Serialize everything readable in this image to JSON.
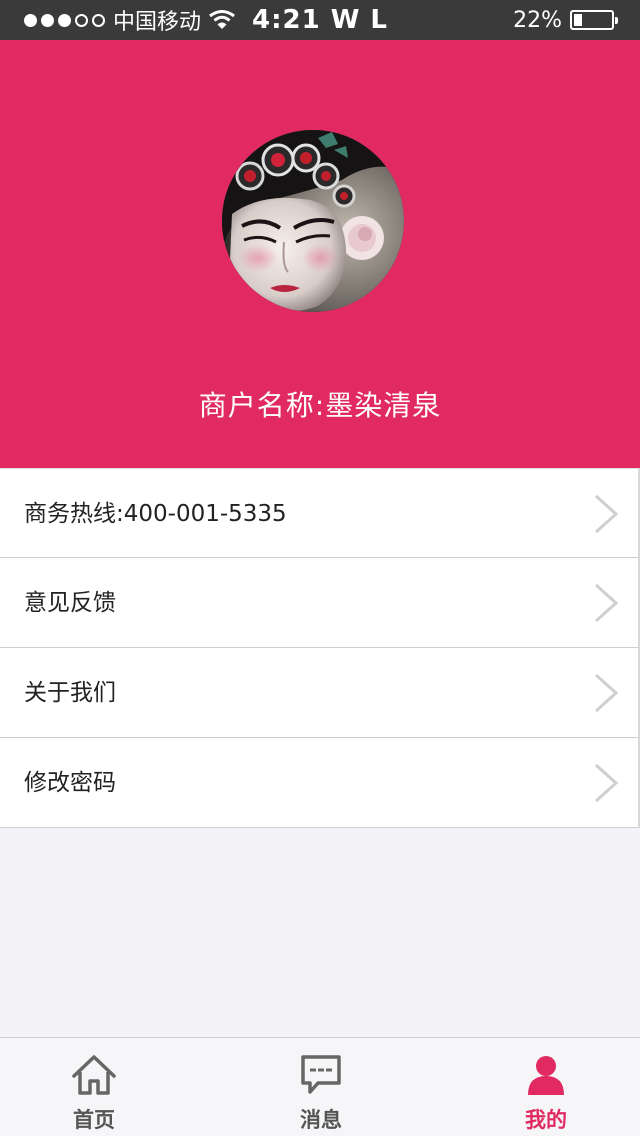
{
  "status_bar": {
    "carrier": "中国移动",
    "time": "4:21 W L",
    "battery_text": "22%",
    "battery_level": 0.22
  },
  "profile": {
    "merchant_name": "商户名称:墨染清泉"
  },
  "menu": [
    {
      "label": "商务热线:400-001-5335"
    },
    {
      "label": "意见反馈"
    },
    {
      "label": "关于我们"
    },
    {
      "label": "修改密码"
    }
  ],
  "tabs": [
    {
      "label": "首页",
      "icon": "home-icon"
    },
    {
      "label": "消息",
      "icon": "message-icon"
    },
    {
      "label": "我的",
      "icon": "user-icon",
      "active": true
    }
  ],
  "colors": {
    "accent": "#e02a61",
    "status_bar": "#3a3a3a",
    "background": "#f4f4f8"
  }
}
